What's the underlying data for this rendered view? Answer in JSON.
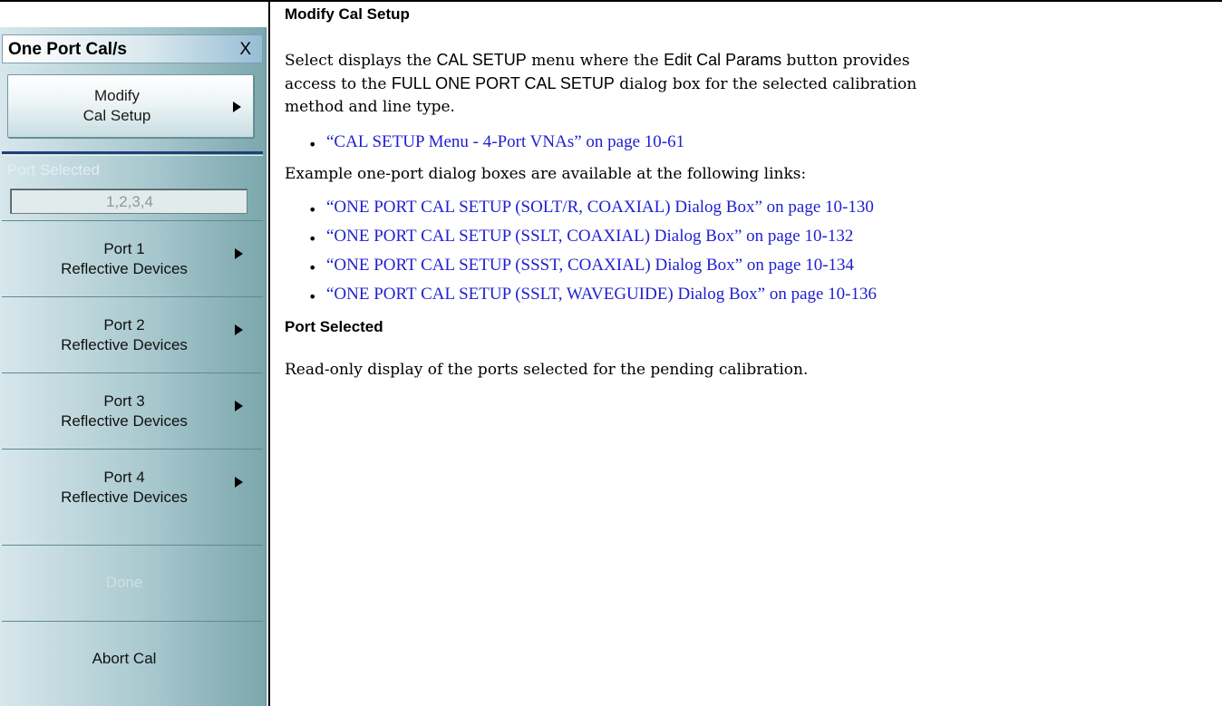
{
  "menu": {
    "title": "One Port Cal/s",
    "close_label": "X",
    "modify": {
      "line1": "Modify",
      "line2": "Cal Setup"
    },
    "port_selected": {
      "label": "Port Selected",
      "value": "1,2,3,4"
    },
    "ports": [
      {
        "line1": "Port 1",
        "line2": "Reflective Devices"
      },
      {
        "line1": "Port 2",
        "line2": "Reflective Devices"
      },
      {
        "line1": "Port 3",
        "line2": "Reflective Devices"
      },
      {
        "line1": "Port 4",
        "line2": "Reflective Devices"
      }
    ],
    "done_label": "Done",
    "abort_label": "Abort Cal"
  },
  "doc": {
    "modify_heading": "Modify Cal Setup",
    "modify_p1": {
      "a": "Select displays the ",
      "b": "CAL SETUP",
      "c": " menu where the ",
      "d": "Edit Cal Params",
      "e": " button provides"
    },
    "modify_p2": {
      "a": "access to the ",
      "b": "FULL ONE PORT CAL SETUP",
      "c": " dialog box for the selected calibration"
    },
    "modify_p3": "method and line type.",
    "link_cal_setup": "“CAL SETUP Menu - 4-Port VNAs” on page 10-61",
    "example_text": "Example one-port dialog boxes are available at the following links:",
    "links": [
      "“ONE PORT CAL SETUP (SOLT/R, COAXIAL) Dialog Box” on page 10-130",
      "“ONE PORT CAL SETUP (SSLT, COAXIAL) Dialog Box” on page 10-132",
      "“ONE PORT CAL SETUP (SSST, COAXIAL) Dialog Box” on page 10-134",
      "“ONE PORT CAL SETUP (SSLT, WAVEGUIDE) Dialog Box” on page 10-136"
    ],
    "port_heading": "Port Selected",
    "port_text": "Read-only display of the ports selected for the pending calibration."
  }
}
